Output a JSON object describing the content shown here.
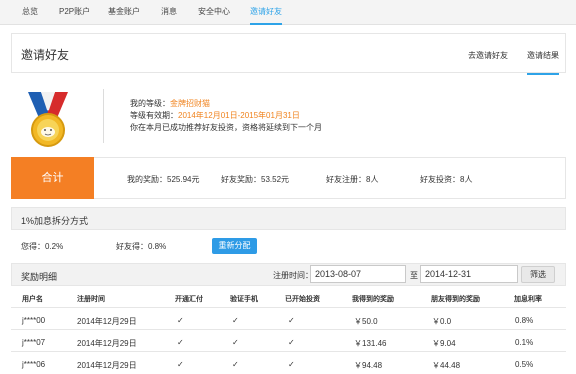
{
  "nav": {
    "items": [
      {
        "label": "总览",
        "active": false
      },
      {
        "label": "P2P账户",
        "active": false
      },
      {
        "label": "基金账户",
        "active": false
      },
      {
        "label": "消息",
        "active": false
      },
      {
        "label": "安全中心",
        "active": false
      },
      {
        "label": "邀请好友",
        "active": true
      }
    ]
  },
  "header": {
    "title": "邀请好友",
    "tabs": [
      {
        "label": "去邀请好友",
        "active": false
      },
      {
        "label": "邀请结果",
        "active": true
      }
    ]
  },
  "level": {
    "level_label": "我的等级：",
    "level_value": "金牌招财猫",
    "period_label": "等级有效期：",
    "period_value": "2014年12月01日-2015年01月31日",
    "note": "你在本月已成功推荐好友投资，资格将延续到下一个月"
  },
  "summary": {
    "total_label": "合计",
    "my_reward": "我的奖励：525.94元",
    "friend_reward": "好友奖励：53.52元",
    "friend_registered": "好友注册：8人",
    "friend_invested": "好友投资：8人"
  },
  "split": {
    "title": "1%加息拆分方式",
    "mine": "您得：0.2%",
    "friend": "好友得：0.8%",
    "redistribute_button": "重新分配"
  },
  "detail": {
    "title": "奖励明细",
    "register_time_label": "注册时间：",
    "date_from": "2013-08-07",
    "to_label": "至",
    "date_to": "2014-12-31",
    "filter_button": "筛选"
  },
  "table": {
    "columns": [
      "用户名",
      "注册时间",
      "开通汇付",
      "验证手机",
      "已开始投资",
      "我得到的奖励",
      "朋友得到的奖励",
      "加息利率"
    ],
    "rows": [
      {
        "user": "j****00",
        "date": "2014年12月29日",
        "huifu": "✓",
        "phone": "✓",
        "invest": "✓",
        "my": "￥50.0",
        "friend": "￥0.0",
        "rate": "0.8%"
      },
      {
        "user": "j****07",
        "date": "2014年12月29日",
        "huifu": "✓",
        "phone": "✓",
        "invest": "✓",
        "my": "￥131.46",
        "friend": "￥9.04",
        "rate": "0.1%"
      },
      {
        "user": "j****06",
        "date": "2014年12月29日",
        "huifu": "✓",
        "phone": "✓",
        "invest": "✓",
        "my": "￥94.48",
        "friend": "￥44.48",
        "rate": "0.5%"
      }
    ]
  },
  "colors": {
    "accent_blue": "#2ea3e8",
    "accent_orange": "#f47f24",
    "text_orange": "#f0831e"
  }
}
